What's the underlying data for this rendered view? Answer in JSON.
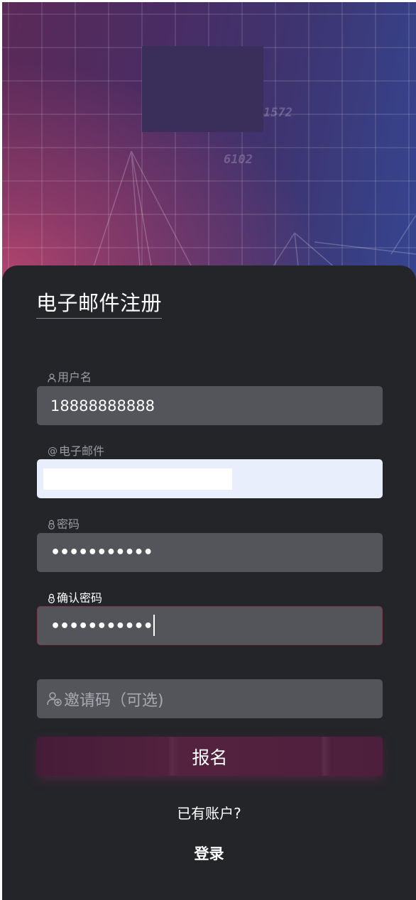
{
  "hero": {
    "text_a": "1572",
    "text_b": "6102"
  },
  "form": {
    "title": "电子邮件注册",
    "username": {
      "label": "用户名",
      "icon": "user-icon",
      "value": "18888888888"
    },
    "email": {
      "label": "电子邮件",
      "icon": "at-icon",
      "value": ""
    },
    "password": {
      "label": "密码",
      "icon": "lock-icon",
      "masked": "•••••••••••"
    },
    "confirm_password": {
      "label": "确认密码",
      "icon": "lock-icon",
      "masked": "•••••••••••"
    },
    "invite_code": {
      "placeholder": "邀请码（可选)",
      "icon": "user-add-icon"
    },
    "submit_label": "报名",
    "have_account_text": "已有账户?",
    "login_label": "登录"
  },
  "colors": {
    "card_bg": "#232529",
    "input_bg": "#53555b",
    "autofill_bg": "#e8eefc",
    "button_bg": "#54223f",
    "label_color": "#9a9ca1"
  }
}
